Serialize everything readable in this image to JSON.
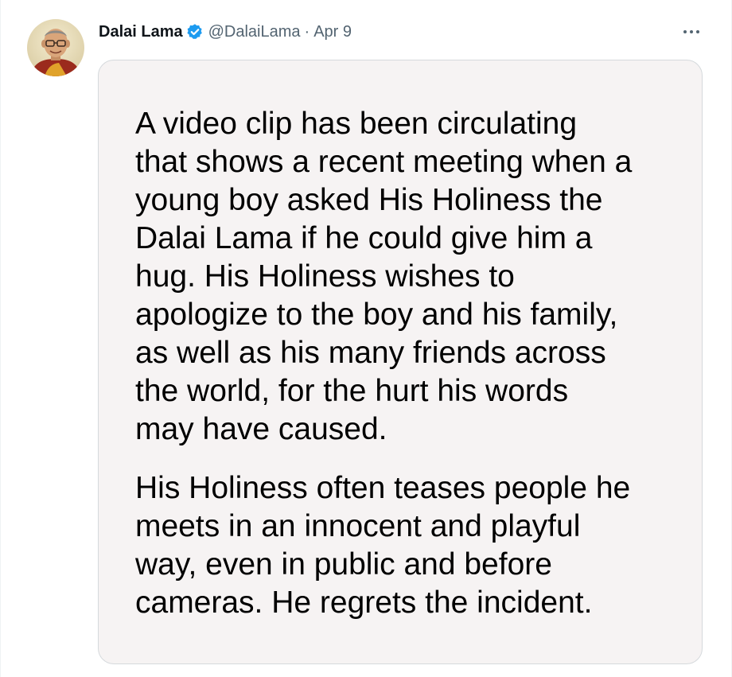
{
  "tweet": {
    "display_name": "Dalai Lama",
    "handle": "@DalaiLama",
    "separator": "·",
    "date": "Apr 9",
    "verified": true,
    "more_icon": "more-horizontal-icon",
    "avatar_icon": "profile-photo"
  },
  "image": {
    "paragraph1": [
      "A video clip has been circulating",
      "that shows a recent meeting when a",
      "young boy asked His Holiness the",
      "Dalai Lama if he could give him a",
      "hug. His Holiness wishes to",
      "apologize to the boy and his family,",
      "as well as his many friends across",
      "the world, for the hurt his words",
      "may have caused."
    ],
    "paragraph2": [
      "His Holiness often teases people he",
      "meets in an innocent and playful",
      "way, even in public and before",
      "cameras. He regrets the incident."
    ]
  },
  "colors": {
    "verified_badge": "#1d9bf0",
    "secondary_text": "#536471",
    "primary_text": "#0f1419",
    "card_background": "#f6f3f3",
    "card_border": "#d5d9dc"
  }
}
